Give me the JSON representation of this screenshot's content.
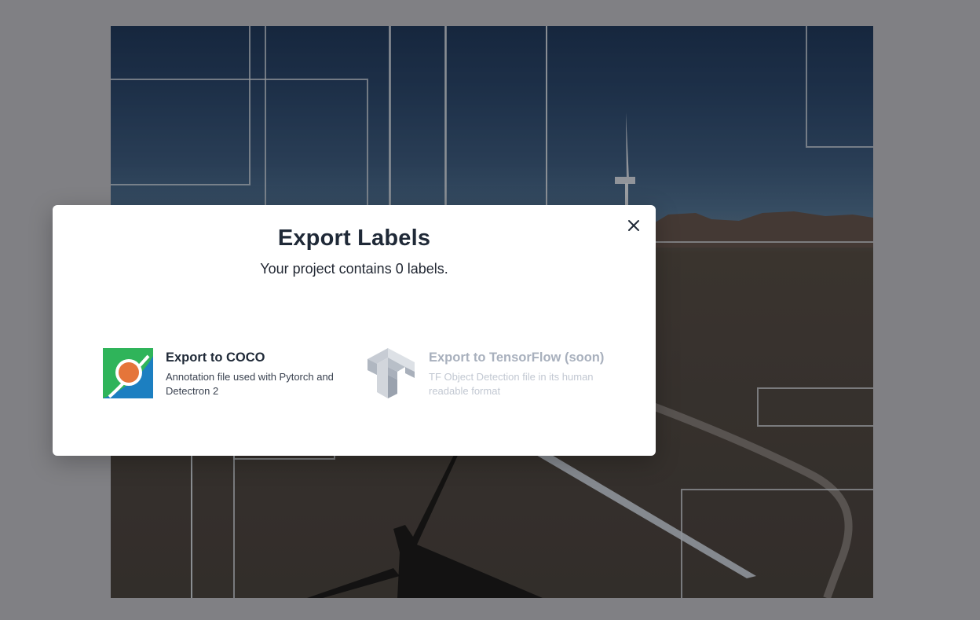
{
  "modal": {
    "title": "Export Labels",
    "subtitle": "Your project contains 0 labels.",
    "close_icon": "close-icon"
  },
  "options": [
    {
      "id": "coco",
      "title": "Export to COCO",
      "description": "Annotation file used with Pytorch and Detectron 2",
      "icon": "coco-logo",
      "enabled": true
    },
    {
      "id": "tensorflow",
      "title": "Export to TensorFlow (soon)",
      "description": "TF Object Detection file in its human readable format",
      "icon": "tensorflow-logo",
      "enabled": false
    }
  ],
  "colors": {
    "overlay": "#808084",
    "modal_bg": "#ffffff",
    "title": "#1f2937",
    "disabled_text": "#a8b0bd",
    "coco_green": "#2fb45a",
    "coco_blue": "#1c7fc1",
    "coco_orange": "#e5753a"
  }
}
